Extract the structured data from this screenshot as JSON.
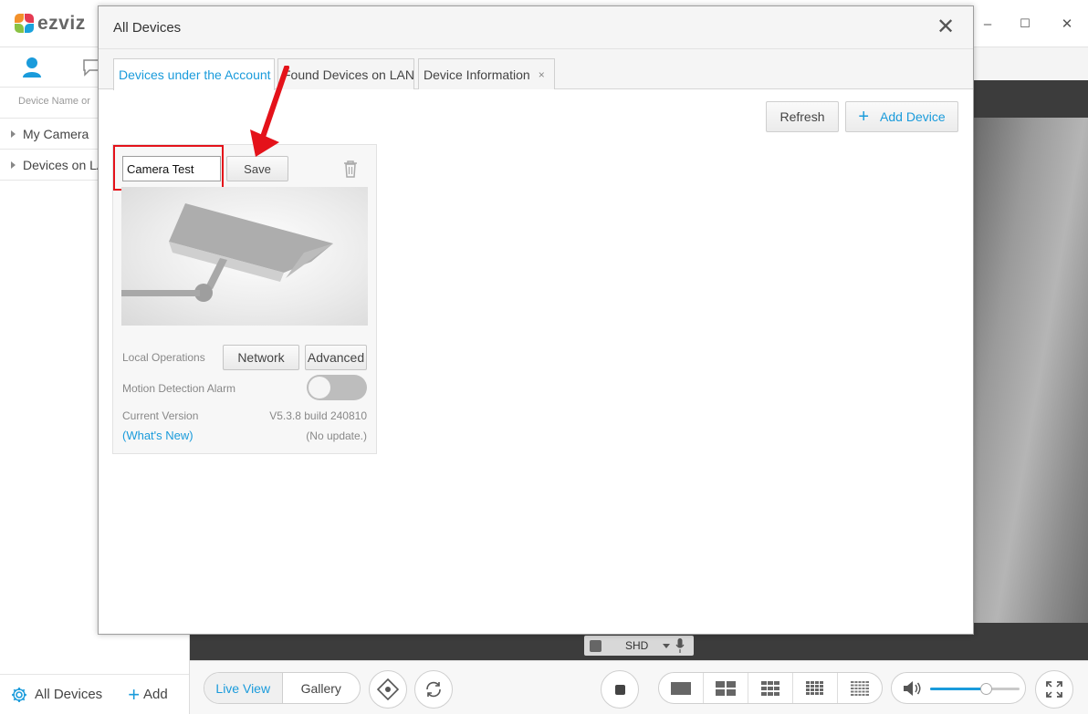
{
  "app": {
    "brand": "ezviz",
    "brand_colors": [
      "#f3912b",
      "#e53a52",
      "#8ac243",
      "#1aa2dc"
    ],
    "accent_color": "#1a9bdb"
  },
  "window_controls": {
    "minimize": "–",
    "maximize": "☐",
    "close": "✕"
  },
  "sidebar": {
    "search_placeholder": "Device Name or",
    "items": [
      {
        "label": "My Camera"
      },
      {
        "label": "Devices on LA"
      }
    ],
    "footer": {
      "all_devices_label": "All Devices",
      "add_label": "Add"
    }
  },
  "video": {
    "quality_label": "SHD"
  },
  "bottombar": {
    "tabs": [
      {
        "label": "Live View",
        "active": true
      },
      {
        "label": "Gallery",
        "active": false
      }
    ],
    "volume_level": 0.62
  },
  "dialog": {
    "title": "All Devices",
    "close_glyph": "✕",
    "tabs": [
      {
        "label": "Devices under the Account",
        "active": true
      },
      {
        "label": "Found Devices on LAN",
        "active": false
      },
      {
        "label": "Device Information",
        "active": false,
        "close": "×"
      }
    ],
    "refresh_label": "Refresh",
    "add_device_label": "Add Device",
    "card": {
      "name_value": "Camera Test",
      "save_label": "Save",
      "local_operations_label": "Local Operations",
      "network_label": "Network",
      "advanced_label": "Advanced",
      "motion_label": "Motion Detection Alarm",
      "motion_enabled": false,
      "current_version_label": "Current Version",
      "version_value": "V5.3.8 build 240810",
      "whats_new_label": "(What's New)",
      "update_status": "(No update.)"
    }
  },
  "annotation": {
    "color": "#e4121a"
  }
}
